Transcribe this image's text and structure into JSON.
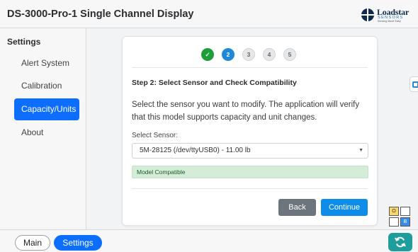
{
  "header": {
    "title": "DS-3000-Pro-1 Single Channel Display"
  },
  "logo": {
    "name": "Loadstar",
    "sub": "SENSORS",
    "tagline": "Sensing Made Easy"
  },
  "sidebar": {
    "heading": "Settings",
    "items": [
      {
        "label": "Alert System",
        "active": false
      },
      {
        "label": "Calibration",
        "active": false
      },
      {
        "label": "Capacity/Units",
        "active": true
      },
      {
        "label": "About",
        "active": false
      }
    ]
  },
  "wizard": {
    "steps": [
      {
        "label": "✓",
        "state": "done"
      },
      {
        "label": "2",
        "state": "current"
      },
      {
        "label": "3",
        "state": "pending"
      },
      {
        "label": "4",
        "state": "pending"
      },
      {
        "label": "5",
        "state": "pending"
      }
    ],
    "step_title": "Step 2: Select Sensor and Check Compatibility",
    "description": "Select the sensor you want to modify. The application will verify that this model supports capacity and unit changes.",
    "select_label": "Select Sensor:",
    "selected_sensor": "5M-28125 (/dev/ttyUSB0) - 11.00 lb",
    "compat_status": "Model Compatible",
    "back_label": "Back",
    "continue_label": "Continue"
  },
  "status_grid": {
    "cells": [
      "O",
      "",
      "",
      "B"
    ]
  },
  "footer": {
    "main_label": "Main",
    "settings_label": "Settings"
  },
  "colors": {
    "accent": "#0d6efd",
    "success": "#1f9d3a",
    "current_step": "#1f88d8",
    "teal": "#1f9d9d"
  }
}
